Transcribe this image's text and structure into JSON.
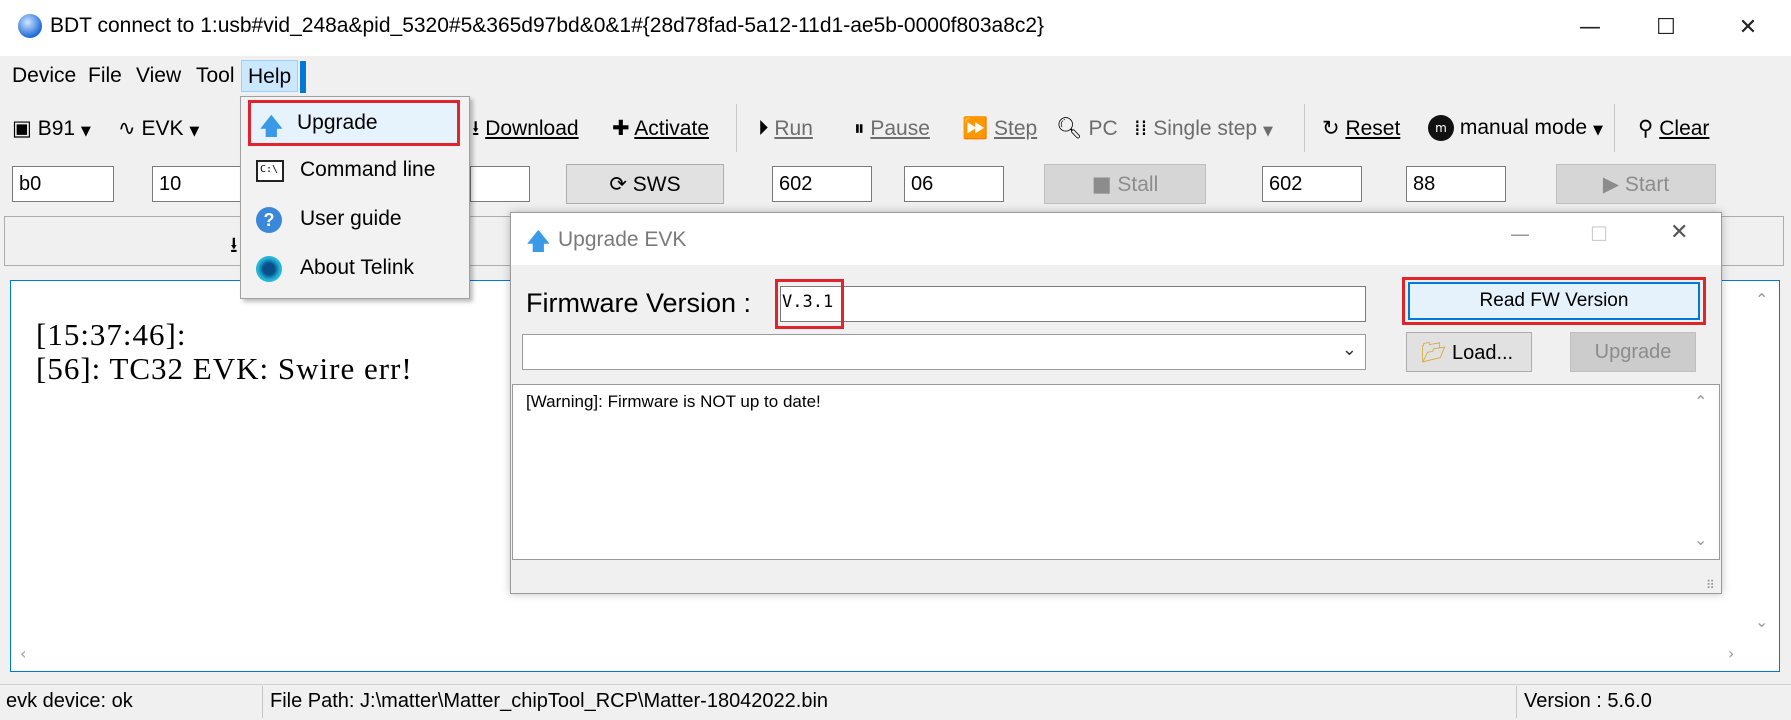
{
  "window": {
    "title": "BDT connect to 1:usb#vid_248a&pid_5320#5&365d97bd&0&1#{28d78fad-5a12-11d1-ae5b-0000f803a8c2}",
    "minimize_glyph": "—",
    "maximize_glyph": "☐",
    "close_glyph": "✕"
  },
  "menubar": {
    "items": [
      "Device",
      "File",
      "View",
      "Tool",
      "Help"
    ]
  },
  "toolbar": {
    "chip": "B91",
    "evk": "EVK",
    "download": "Download",
    "activate": "Activate",
    "run": "Run",
    "pause": "Pause",
    "step": "Step",
    "pc": "PC",
    "single_step": "Single step",
    "reset": "Reset",
    "manual_mode": "manual mode",
    "clear": "Clear"
  },
  "fields": {
    "f1": "b0",
    "f2": "10",
    "sws": "SWS",
    "f3": "602",
    "f4": "06",
    "stall": "Stall",
    "f5": "602",
    "f6": "88",
    "start": "Start"
  },
  "help_menu": {
    "items": [
      {
        "label": "Upgrade",
        "icon": "upgrade-arrow-icon"
      },
      {
        "label": "Command line",
        "icon": "command-line-icon"
      },
      {
        "label": "User guide",
        "icon": "help-icon"
      },
      {
        "label": "About Telink",
        "icon": "telink-icon"
      }
    ]
  },
  "console": {
    "line1": "[15:37:46]:",
    "line2": "[56]: TC32 EVK: Swire err!"
  },
  "dialog": {
    "title": "Upgrade EVK",
    "fw_label": "Firmware Version :",
    "fw_value": "V.3.1",
    "read_button": "Read FW Version",
    "load_button": "Load...",
    "upgrade_button": "Upgrade",
    "file_select": "",
    "log": "[Warning]: Firmware is NOT up to date!"
  },
  "status": {
    "device": "evk device: ok",
    "file_path": "File Path:  J:\\matter\\Matter_chipTool_RCP\\Matter-18042022.bin",
    "version": "Version : 5.6.0"
  },
  "colors": {
    "accent": "#0078d7",
    "highlight_red": "#e0242b",
    "menu_hover": "#cce8ff"
  }
}
